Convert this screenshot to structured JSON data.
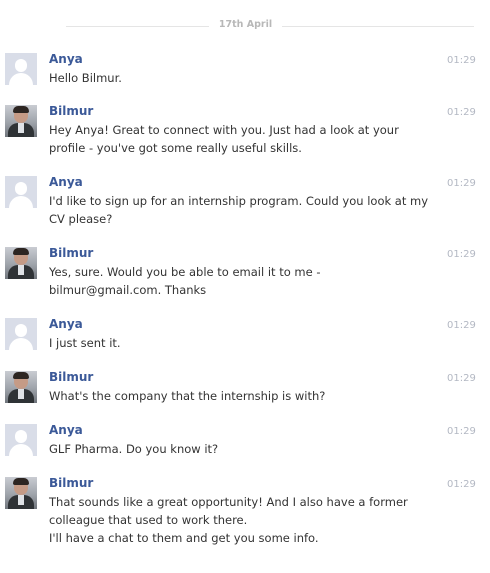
{
  "date_divider": "17th April",
  "messages": [
    {
      "sender": "Anya",
      "avatar": "default-profile-icon",
      "time": "01:29",
      "text": "Hello Bilmur."
    },
    {
      "sender": "Bilmur",
      "avatar": "user-photo",
      "time": "01:29",
      "text": "Hey Anya! Great to connect with you. Just had a look at your\nprofile - you've got some really useful skills."
    },
    {
      "sender": "Anya",
      "avatar": "default-profile-icon",
      "time": "01:29",
      "text": "I'd like to sign up for an internship program. Could you look at my\nCV please?"
    },
    {
      "sender": "Bilmur",
      "avatar": "user-photo",
      "time": "01:29",
      "text": "Yes, sure. Would you be able to email it to me -\nbilmur@gmail.com. Thanks"
    },
    {
      "sender": "Anya",
      "avatar": "default-profile-icon",
      "time": "01:29",
      "text": "I just sent it."
    },
    {
      "sender": "Bilmur",
      "avatar": "user-photo",
      "time": "01:29",
      "text": "What's the company that the internship is with?"
    },
    {
      "sender": "Anya",
      "avatar": "default-profile-icon",
      "time": "01:29",
      "text": "GLF Pharma. Do you know it?"
    },
    {
      "sender": "Bilmur",
      "avatar": "user-photo",
      "time": "01:29",
      "text": "That sounds like a great opportunity! And I also have a former\ncolleague that used to work there.\nI'll have a chat to them and get you some info."
    }
  ],
  "colors": {
    "sender_name": "#3b5998",
    "message_text": "#333333",
    "timestamp": "#b3b8c3",
    "divider": "#e5e5e5"
  }
}
